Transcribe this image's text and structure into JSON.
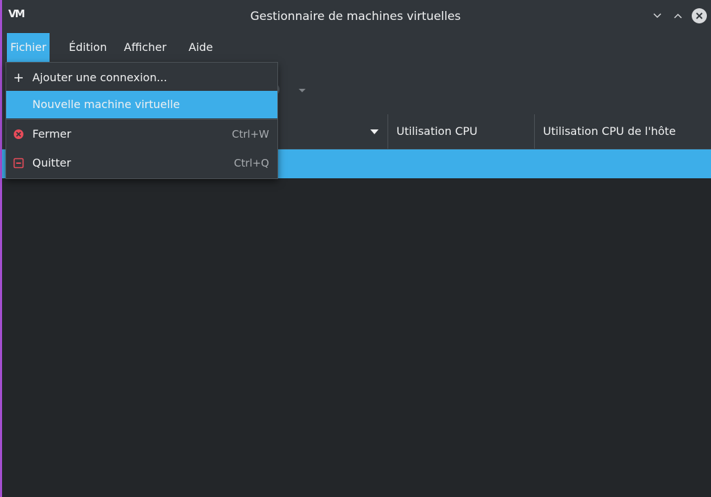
{
  "window": {
    "logo": "VM",
    "title": "Gestionnaire de machines virtuelles"
  },
  "menubar": {
    "items": [
      {
        "label": "Fichier",
        "active": true
      },
      {
        "label": "Édition"
      },
      {
        "label": "Afficher"
      },
      {
        "label": "Aide"
      }
    ]
  },
  "file_menu": {
    "items": [
      {
        "label": "Ajouter une connexion...",
        "icon": "plus-icon",
        "shortcut": ""
      },
      {
        "label": "Nouvelle machine virtuelle",
        "icon": "",
        "shortcut": "",
        "highlighted": true
      },
      {
        "label": "Fermer",
        "icon": "close-circle-icon",
        "shortcut": "Ctrl+W"
      },
      {
        "label": "Quitter",
        "icon": "quit-icon",
        "shortcut": "Ctrl+Q"
      }
    ]
  },
  "table": {
    "columns": [
      {
        "label": ""
      },
      {
        "label": "Utilisation CPU"
      },
      {
        "label": "Utilisation CPU de l'hôte"
      }
    ]
  },
  "colors": {
    "accent": "#3daee9",
    "background": "#232629",
    "panel": "#31363b",
    "close_icon": "#e84c5a",
    "quit_icon": "#e84c5a",
    "left_border": "#a54fd1"
  }
}
